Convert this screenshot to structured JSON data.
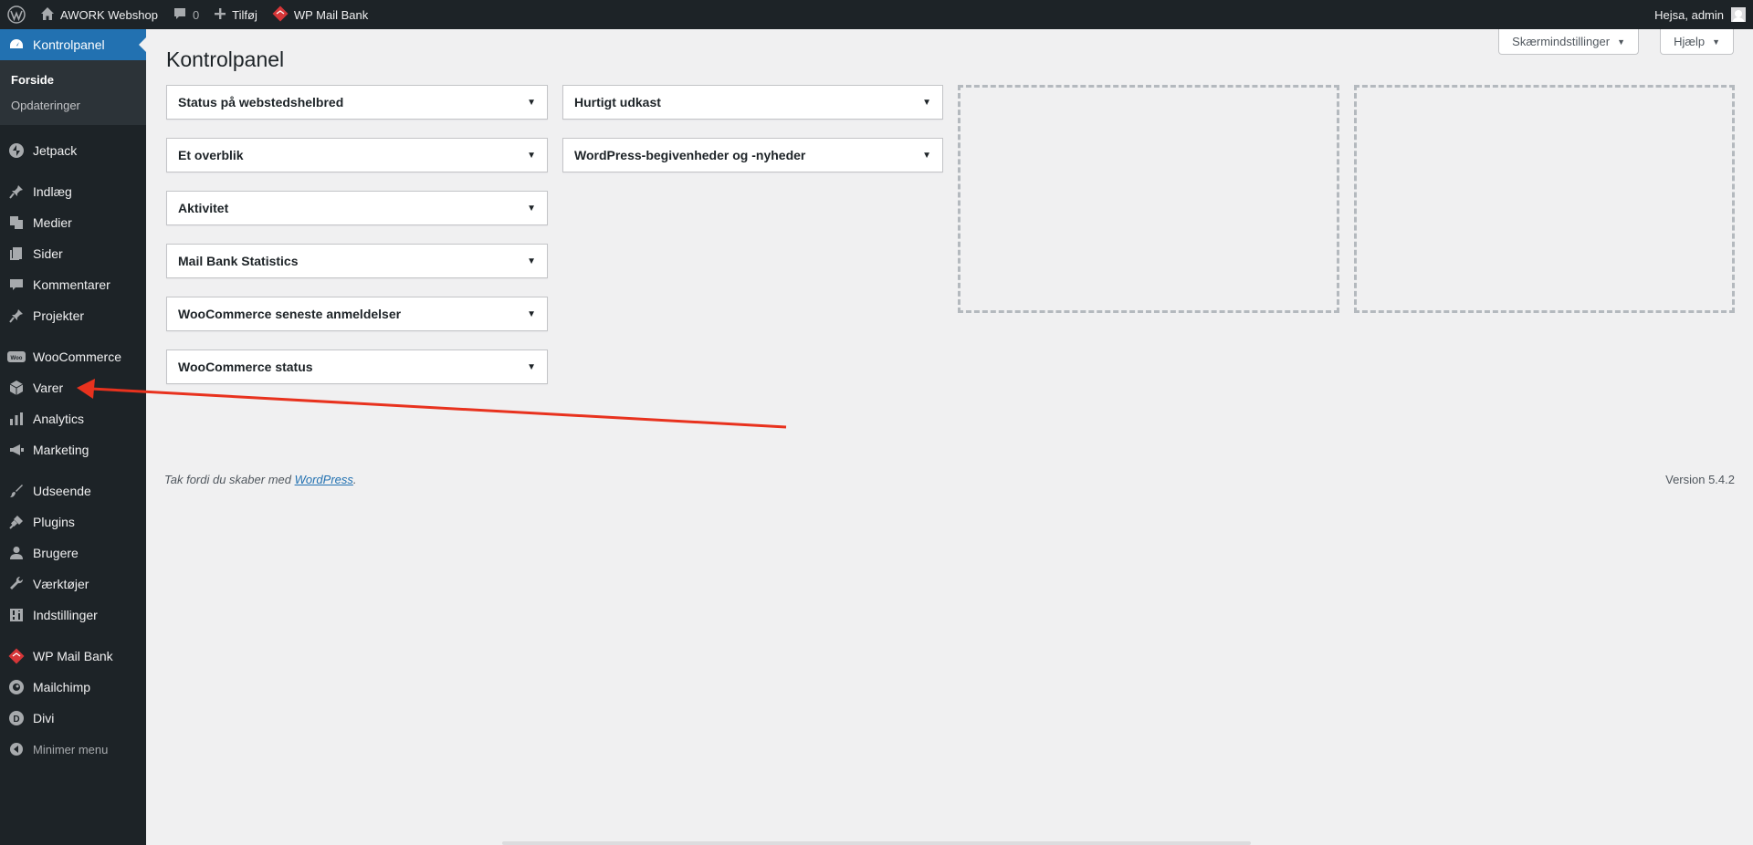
{
  "adminbar": {
    "site_name": "AWORK Webshop",
    "comments_count": "0",
    "new_label": "Tilføj",
    "mailbank_label": "WP Mail Bank",
    "greeting": "Hejsa, admin"
  },
  "sidebar": {
    "dashboard": "Kontrolpanel",
    "sub_home": "Forside",
    "sub_updates": "Opdateringer",
    "jetpack": "Jetpack",
    "posts": "Indlæg",
    "media": "Medier",
    "pages": "Sider",
    "comments": "Kommentarer",
    "projects": "Projekter",
    "woocommerce": "WooCommerce",
    "products": "Varer",
    "analytics": "Analytics",
    "marketing": "Marketing",
    "appearance": "Udseende",
    "plugins": "Plugins",
    "users": "Brugere",
    "tools": "Værktøjer",
    "settings": "Indstillinger",
    "wpmailbank": "WP Mail Bank",
    "mailchimp": "Mailchimp",
    "divi": "Divi",
    "collapse": "Minimer menu"
  },
  "page": {
    "title": "Kontrolpanel",
    "screen_options": "Skærmindstillinger",
    "help": "Hjælp"
  },
  "widgets": {
    "site_health": "Status på webstedshelbred",
    "at_a_glance": "Et overblik",
    "activity": "Aktivitet",
    "mailbank_stats": "Mail Bank Statistics",
    "woo_reviews": "WooCommerce seneste anmeldelser",
    "woo_status": "WooCommerce status",
    "quick_draft": "Hurtigt udkast",
    "events_news": "WordPress-begivenheder og -nyheder"
  },
  "footer": {
    "thanks_prefix": "Tak fordi du skaber med ",
    "thanks_link": "WordPress",
    "thanks_suffix": ".",
    "version": "Version 5.4.2"
  },
  "colors": {
    "accent": "#2271b1",
    "annotation_arrow": "#e8321e"
  }
}
